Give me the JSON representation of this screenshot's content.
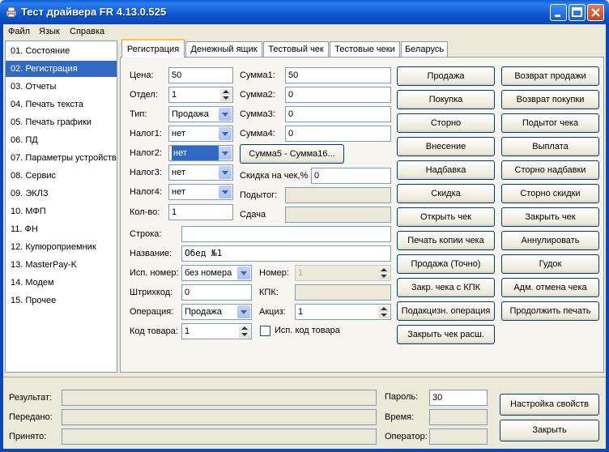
{
  "window": {
    "title": "Тест драйвера FR 4.13.0.525"
  },
  "menu": [
    "Файл",
    "Язык",
    "Справка"
  ],
  "nav": [
    "01. Состояние",
    "02. Регистрация",
    "03. Отчеты",
    "04. Печать текста",
    "05. Печать графики",
    "06. ПД",
    "07. Параметры устройства",
    "08. Сервис",
    "09. ЭКЛЗ",
    "10. МФП",
    "11. ФН",
    "12. Купюроприемник",
    "13. MasterPay-K",
    "14. Модем",
    "15. Прочее"
  ],
  "tabs": [
    "Регистрация",
    "Денежный ящик",
    "Тестовый чек",
    "Тестовые чеки",
    "Беларусь"
  ],
  "form": {
    "price_label": "Цена:",
    "price": "50",
    "dept_label": "Отдел:",
    "dept": "1",
    "type_label": "Тип:",
    "type": "Продажа",
    "tax1_label": "Налог1:",
    "tax1": "нет",
    "tax2_label": "Налог2:",
    "tax2": "нет",
    "tax3_label": "Налог3:",
    "tax3": "нет",
    "tax4_label": "Налог4:",
    "tax4": "нет",
    "qty_label": "Кол-во:",
    "qty": "1",
    "sum1_label": "Сумма1:",
    "sum1": "50",
    "sum2_label": "Сумма2:",
    "sum2": "0",
    "sum3_label": "Сумма3:",
    "sum3": "0",
    "sum4_label": "Сумма4:",
    "sum4": "0",
    "sum5_16_button": "Сумма5 - Сумма16...",
    "discount_label": "Скидка на чек,%",
    "discount": "0",
    "subtotal_label": "Подытог:",
    "change_label": "Сдача",
    "line_label": "Строка:",
    "line": "",
    "name_label": "Название:",
    "name": "Обед №1",
    "use_number_label": "Исп. номер:",
    "use_number": "без номера",
    "number_label": "Номер:",
    "number": "1",
    "barcode_label": "Штрихкод:",
    "barcode": "0",
    "kpk_label": "КПК:",
    "operation_label": "Операция:",
    "operation": "Продажа",
    "excise_label": "Акциз:",
    "excise": "1",
    "product_code_label": "Код товара:",
    "product_code": "1",
    "use_product_code_label": "Исп. код товара"
  },
  "buttons_left": [
    "Продажа",
    "Покупка",
    "Сторно",
    "Внесение",
    "Надбавка",
    "Скидка",
    "Открыть чек",
    "Печать копии чека",
    "Продажа (Точно)",
    "Закр. чека с КПК",
    "Подакцизн. операция",
    "Закрыть чек расш."
  ],
  "buttons_right": [
    "Возврат продажи",
    "Возврат покупки",
    "Подытог чека",
    "Выплата",
    "Сторно надбавки",
    "Сторно скидки",
    "Закрыть чек",
    "Аннулировать",
    "Гудок",
    "Адм. отмена чека",
    "Продолжить печать"
  ],
  "bottom": {
    "result_label": "Результат:",
    "sent_label": "Передано:",
    "received_label": "Принято:",
    "password_label": "Пароль:",
    "password": "30",
    "time_label": "Время:",
    "operator_label": "Оператор:",
    "settings_button": "Настройка свойств",
    "close_button": "Закрыть"
  },
  "colors": {
    "accent": "#316ac5",
    "titlebar": "#0a5fd8",
    "background": "#ece9d8"
  }
}
